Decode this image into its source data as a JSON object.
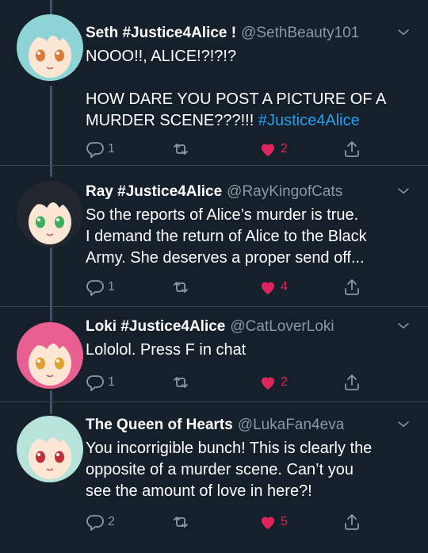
{
  "tweets": [
    {
      "name": "Seth #Justice4Alice !",
      "handle": "@SethBeauty101",
      "text_lines": [
        "NOOO!!, ALICE!?!?!?",
        "",
        "HOW DARE YOU POST A PICTURE OF A",
        "MURDER SCENE???!!! "
      ],
      "hashtag": "#Justice4Alice",
      "replies": "1",
      "retweets": "",
      "likes": "2",
      "avatar": {
        "hair": "#8ed4d6",
        "skin": "#fde6d4",
        "eye": "#d97a3a"
      }
    },
    {
      "name": "Ray #Justice4Alice",
      "handle": "@RayKingofCats",
      "text_lines": [
        "So the reports of Alice’s murder is true.",
        "I demand the return of Alice to the Black",
        "Army. She deserves a proper send off..."
      ],
      "replies": "1",
      "retweets": "",
      "likes": "4",
      "avatar": {
        "hair": "#22262e",
        "skin": "#fde6d4",
        "eye": "#3fae5a"
      }
    },
    {
      "name": "Loki #Justice4Alice",
      "handle": "@CatLoverLoki",
      "text_lines": [
        "Lololol. Press F in chat"
      ],
      "replies": "1",
      "retweets": "",
      "likes": "2",
      "avatar": {
        "hair": "#ea5f92",
        "skin": "#fde6d4",
        "eye": "#e0a030"
      }
    },
    {
      "name": "The Queen of Hearts",
      "handle": "@LukaFan4eva",
      "text_lines": [
        "You incorrigible bunch! This is clearly the",
        "opposite of a murder scene. Can’t you",
        "see the amount of love in here?!"
      ],
      "replies": "2",
      "retweets": "",
      "likes": "5",
      "avatar": {
        "hair": "#b7e3da",
        "skin": "#fde6d4",
        "eye": "#c0303a"
      }
    }
  ],
  "colors": {
    "background": "#15202b",
    "handle": "#8899a6",
    "hashtag": "#1da1f2",
    "like": "#e0245e",
    "divider": "#38444d"
  },
  "icons": [
    "reply-icon",
    "retweet-icon",
    "like-icon",
    "share-icon",
    "chevron-down-icon"
  ]
}
